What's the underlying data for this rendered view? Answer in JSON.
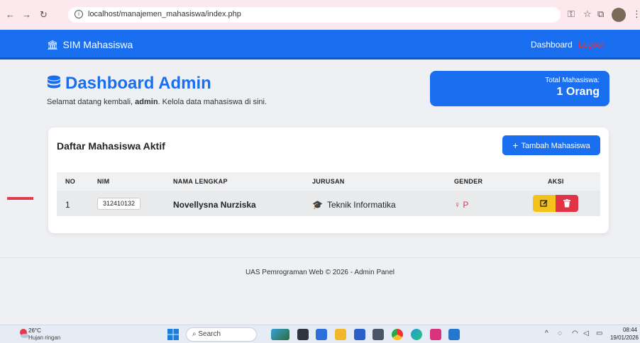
{
  "browser": {
    "url": "localhost/manajemen_mahasiswa/index.php"
  },
  "navbar": {
    "brand": "SIM Mahasiswa",
    "links": [
      "Dashboard",
      "Logout"
    ]
  },
  "header": {
    "title": "Dashboard Admin",
    "subtitle_prefix": "Selamat datang kembali, ",
    "subtitle_user": "admin",
    "subtitle_suffix": ". Kelola data mahasiswa di sini."
  },
  "stats": {
    "label": "Total Mahasiswa:",
    "value": "1 Orang"
  },
  "table_card": {
    "title": "Daftar Mahasiswa Aktif",
    "add_button": "Tambah Mahasiswa",
    "columns": [
      "NO",
      "NIM",
      "NAMA LENGKAP",
      "JURUSAN",
      "GENDER",
      "AKSI"
    ],
    "rows": [
      {
        "no": "1",
        "nim": "312410132",
        "nama": "Novellysna Nurziska",
        "jurusan": "Teknik Informatika",
        "gender": "P"
      }
    ]
  },
  "footer": "UAS Pemrograman Web © 2026 - Admin Panel",
  "taskbar": {
    "weather_temp": "26°C",
    "weather_cond": "Hujan ringan",
    "search": "Search",
    "time": "08:44",
    "date": "19/01/2026"
  },
  "colors": {
    "primary": "#1a6ff0",
    "danger": "#e13345",
    "warning": "#f5c21b"
  }
}
